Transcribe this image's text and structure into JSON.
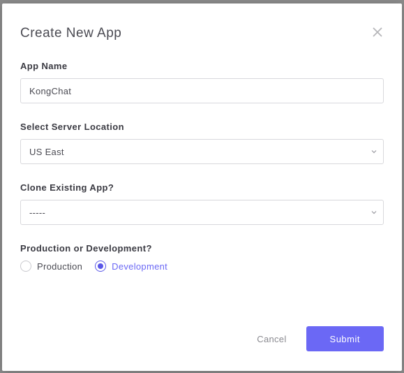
{
  "modal": {
    "title": "Create New App"
  },
  "form": {
    "app_name": {
      "label": "App Name",
      "value": "KongChat"
    },
    "server_location": {
      "label": "Select Server Location",
      "selected": "US East"
    },
    "clone_app": {
      "label": "Clone Existing App?",
      "selected": "-----"
    },
    "environment": {
      "label": "Production or Development?",
      "options": {
        "production": "Production",
        "development": "Development"
      },
      "selected": "development"
    }
  },
  "actions": {
    "cancel": "Cancel",
    "submit": "Submit"
  }
}
